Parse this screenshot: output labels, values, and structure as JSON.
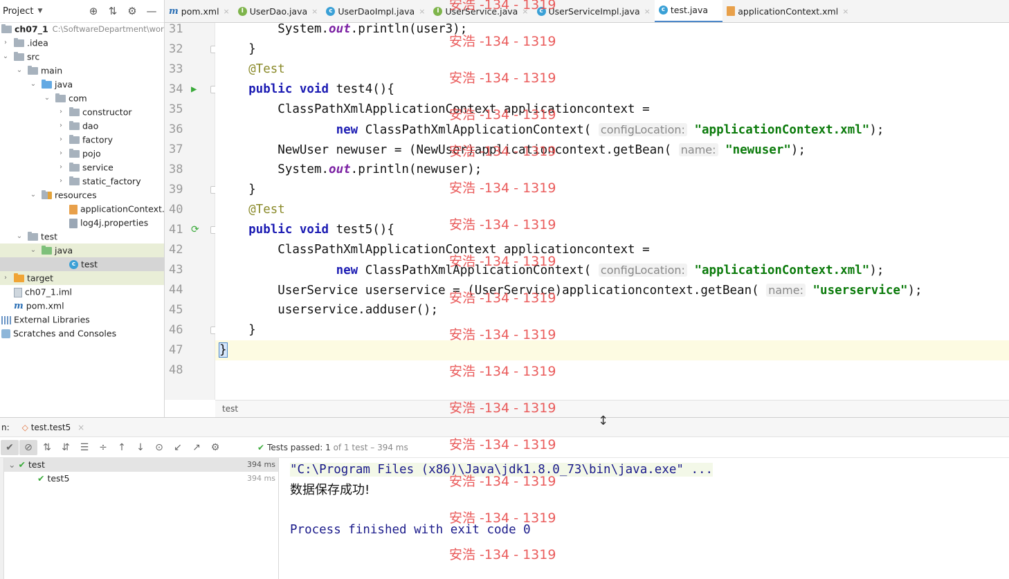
{
  "sidebar": {
    "title": "Project",
    "tools": [
      "⊕",
      "⇅",
      "⚙",
      "—"
    ],
    "tree": [
      {
        "label": "ch07_1",
        "path": "C:\\SoftwareDepartment\\work",
        "icon": "folder",
        "indent": 0,
        "arrow": "⌄",
        "bold": true
      },
      {
        "label": ".idea",
        "icon": "folder",
        "indent": 1,
        "arrow": "›"
      },
      {
        "label": "src",
        "icon": "folder",
        "indent": 1,
        "arrow": "⌄"
      },
      {
        "label": "main",
        "icon": "folder",
        "indent": 2,
        "arrow": "⌄"
      },
      {
        "label": "java",
        "icon": "folder-blue",
        "indent": 3,
        "arrow": "⌄"
      },
      {
        "label": "com",
        "icon": "folder",
        "indent": 4,
        "arrow": "⌄"
      },
      {
        "label": "constructor",
        "icon": "folder",
        "indent": 5,
        "arrow": "›"
      },
      {
        "label": "dao",
        "icon": "folder",
        "indent": 5,
        "arrow": "›"
      },
      {
        "label": "factory",
        "icon": "folder",
        "indent": 5,
        "arrow": "›"
      },
      {
        "label": "pojo",
        "icon": "folder",
        "indent": 5,
        "arrow": "›"
      },
      {
        "label": "service",
        "icon": "folder",
        "indent": 5,
        "arrow": "›"
      },
      {
        "label": "static_factory",
        "icon": "folder",
        "indent": 5,
        "arrow": "›"
      },
      {
        "label": "resources",
        "icon": "folder-res",
        "indent": 3,
        "arrow": "⌄"
      },
      {
        "label": "applicationContext.xml",
        "icon": "xml",
        "indent": 5,
        "arrow": ""
      },
      {
        "label": "log4j.properties",
        "icon": "properties",
        "indent": 5,
        "arrow": ""
      },
      {
        "label": "test",
        "icon": "folder",
        "indent": 2,
        "arrow": "⌄"
      },
      {
        "label": "java",
        "icon": "folder-green",
        "indent": 3,
        "arrow": "⌄",
        "highlight": true
      },
      {
        "label": "test",
        "icon": "class",
        "indent": 5,
        "arrow": "",
        "selected": true
      },
      {
        "label": "target",
        "icon": "folder-orange",
        "indent": 1,
        "arrow": "›",
        "highlight": true
      },
      {
        "label": "ch07_1.iml",
        "icon": "iml",
        "indent": 1,
        "arrow": ""
      },
      {
        "label": "pom.xml",
        "icon": "maven",
        "indent": 1,
        "arrow": ""
      },
      {
        "label": "External Libraries",
        "icon": "libraries",
        "indent": 0,
        "arrow": "›"
      },
      {
        "label": "Scratches and Consoles",
        "icon": "scratches",
        "indent": 0,
        "arrow": "›"
      }
    ]
  },
  "tabs": [
    {
      "label": "pom.xml",
      "icon": "maven",
      "active": false
    },
    {
      "label": "UserDao.java",
      "icon": "interface",
      "active": false
    },
    {
      "label": "UserDaoImpl.java",
      "icon": "class",
      "active": false
    },
    {
      "label": "UserService.java",
      "icon": "interface",
      "active": false
    },
    {
      "label": "UserServiceImpl.java",
      "icon": "class",
      "active": false
    },
    {
      "label": "test.java",
      "icon": "class",
      "active": true
    },
    {
      "label": "applicationContext.xml",
      "icon": "xml",
      "active": false
    }
  ],
  "editor": {
    "lines": [
      {
        "num": "31",
        "parts": [
          [
            "",
            "        System."
          ],
          [
            "field",
            "out"
          ],
          [
            "",
            ".println(user3);"
          ]
        ]
      },
      {
        "num": "32",
        "fold": true,
        "parts": [
          [
            "",
            "    }"
          ]
        ]
      },
      {
        "num": "33",
        "parts": [
          [
            "ann",
            "    @Test"
          ]
        ]
      },
      {
        "num": "34",
        "run": "▶",
        "fold": true,
        "parts": [
          [
            "kw",
            "    public void "
          ],
          [
            "",
            "test4(){"
          ]
        ]
      },
      {
        "num": "35",
        "parts": [
          [
            "",
            "        ClassPathXmlApplicationContext applicationcontext ="
          ]
        ]
      },
      {
        "num": "36",
        "parts": [
          [
            "",
            "                "
          ],
          [
            "kw",
            "new "
          ],
          [
            "",
            "ClassPathXmlApplicationContext( "
          ],
          [
            "hint",
            "configLocation:"
          ],
          [
            "",
            " "
          ],
          [
            "str",
            "\"applicationContext.xml\""
          ],
          [
            "",
            ");"
          ]
        ]
      },
      {
        "num": "37",
        "parts": [
          [
            "",
            "        NewUser newuser = (NewUser)applicationcontext.getBean( "
          ],
          [
            "hint",
            "name:"
          ],
          [
            "",
            " "
          ],
          [
            "str",
            "\"newuser\""
          ],
          [
            "",
            ");"
          ]
        ]
      },
      {
        "num": "38",
        "parts": [
          [
            "",
            "        System."
          ],
          [
            "field",
            "out"
          ],
          [
            "",
            ".println(newuser);"
          ]
        ]
      },
      {
        "num": "39",
        "fold": true,
        "parts": [
          [
            "",
            "    }"
          ]
        ]
      },
      {
        "num": "40",
        "parts": [
          [
            "ann",
            "    @Test"
          ]
        ]
      },
      {
        "num": "41",
        "run": "⟳",
        "fold": true,
        "parts": [
          [
            "kw",
            "    public void "
          ],
          [
            "",
            "test5(){"
          ]
        ]
      },
      {
        "num": "42",
        "parts": [
          [
            "",
            "        ClassPathXmlApplicationContext applicationcontext ="
          ]
        ]
      },
      {
        "num": "43",
        "parts": [
          [
            "",
            "                "
          ],
          [
            "kw",
            "new "
          ],
          [
            "",
            "ClassPathXmlApplicationContext( "
          ],
          [
            "hint",
            "configLocation:"
          ],
          [
            "",
            " "
          ],
          [
            "str",
            "\"applicationContext.xml\""
          ],
          [
            "",
            ");"
          ]
        ]
      },
      {
        "num": "44",
        "parts": [
          [
            "",
            "        UserService userservice = (UserService)applicationcontext.getBean( "
          ],
          [
            "hint",
            "name:"
          ],
          [
            "",
            " "
          ],
          [
            "str",
            "\"userservice\""
          ],
          [
            "",
            ");"
          ]
        ]
      },
      {
        "num": "45",
        "parts": [
          [
            "",
            "        userservice.adduser();"
          ]
        ]
      },
      {
        "num": "46",
        "fold": true,
        "parts": [
          [
            "",
            "    }"
          ]
        ]
      },
      {
        "num": "47",
        "current": true,
        "parts": [
          [
            "brace",
            "}"
          ]
        ]
      },
      {
        "num": "48",
        "parts": [
          [
            "",
            ""
          ]
        ]
      }
    ],
    "breadcrumb": "test"
  },
  "run_panel": {
    "label": "n:",
    "tab": "test.test5",
    "status": {
      "check": "✔",
      "passed": "Tests passed:",
      "count": "1",
      "rest": "of 1 test – 394 ms"
    },
    "tree": [
      {
        "label": "test",
        "duration": "394 ms",
        "indent": 0,
        "selected": true
      },
      {
        "label": "test5",
        "duration": "394 ms",
        "indent": 1,
        "selected": false
      }
    ],
    "console": {
      "command": "\"C:\\Program Files (x86)\\Java\\jdk1.8.0_73\\bin\\java.exe\" ...",
      "output": "数据保存成功!",
      "blank": "",
      "exit": "Process finished with exit code 0"
    }
  },
  "watermark": "安浩 -134 - 1319",
  "colors": {
    "accent": "#4a86c8",
    "keyword": "#1b1bb3",
    "string": "#0a7a0a",
    "watermark": "#e84a4a",
    "pass": "#3aaa3a"
  }
}
